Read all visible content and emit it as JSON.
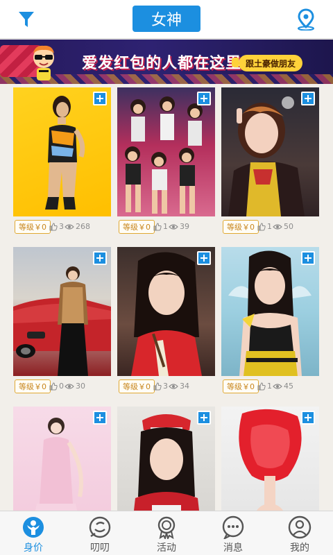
{
  "header": {
    "title": "女神",
    "filter_icon": "filter-icon",
    "location_icon": "location-pin-icon"
  },
  "banner": {
    "text": "爱发红包的人都在这里了",
    "cta": "跟土豪做朋友"
  },
  "cards": [
    {
      "level": "等级￥0",
      "likes": "3",
      "views": "268"
    },
    {
      "level": "等级￥0",
      "likes": "1",
      "views": "39"
    },
    {
      "level": "等级￥0",
      "likes": "1",
      "views": "50"
    },
    {
      "level": "等级￥0",
      "likes": "0",
      "views": "30"
    },
    {
      "level": "等级￥0",
      "likes": "3",
      "views": "34"
    },
    {
      "level": "等级￥0",
      "likes": "1",
      "views": "45"
    },
    {
      "level": "",
      "likes": "",
      "views": ""
    },
    {
      "level": "",
      "likes": "",
      "views": ""
    },
    {
      "level": "",
      "likes": "",
      "views": ""
    }
  ],
  "tabs": [
    {
      "label": "身价",
      "icon": "person-value-icon",
      "active": true
    },
    {
      "label": "叨叨",
      "icon": "chat-bubble-icon",
      "active": false
    },
    {
      "label": "活动",
      "icon": "medal-icon",
      "active": false
    },
    {
      "label": "消息",
      "icon": "message-dots-icon",
      "active": false
    },
    {
      "label": "我的",
      "icon": "profile-icon",
      "active": false
    }
  ],
  "colors": {
    "accent": "#1c8fe0",
    "level_border": "#e0a832",
    "background": "#f2efea"
  }
}
